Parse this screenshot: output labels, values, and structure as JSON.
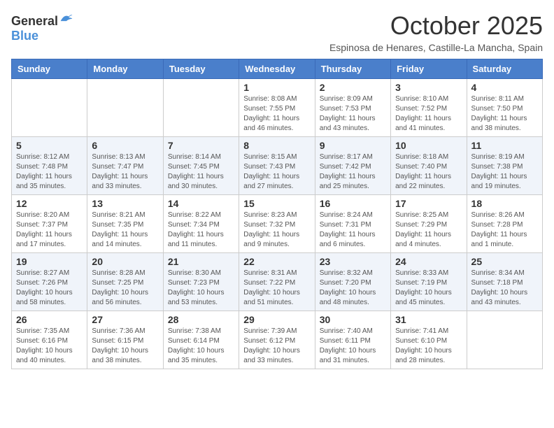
{
  "header": {
    "logo_general": "General",
    "logo_blue": "Blue",
    "month_title": "October 2025",
    "subtitle": "Espinosa de Henares, Castille-La Mancha, Spain"
  },
  "weekdays": [
    "Sunday",
    "Monday",
    "Tuesday",
    "Wednesday",
    "Thursday",
    "Friday",
    "Saturday"
  ],
  "weeks": [
    [
      {
        "day": "",
        "info": ""
      },
      {
        "day": "",
        "info": ""
      },
      {
        "day": "",
        "info": ""
      },
      {
        "day": "1",
        "info": "Sunrise: 8:08 AM\nSunset: 7:55 PM\nDaylight: 11 hours and 46 minutes."
      },
      {
        "day": "2",
        "info": "Sunrise: 8:09 AM\nSunset: 7:53 PM\nDaylight: 11 hours and 43 minutes."
      },
      {
        "day": "3",
        "info": "Sunrise: 8:10 AM\nSunset: 7:52 PM\nDaylight: 11 hours and 41 minutes."
      },
      {
        "day": "4",
        "info": "Sunrise: 8:11 AM\nSunset: 7:50 PM\nDaylight: 11 hours and 38 minutes."
      }
    ],
    [
      {
        "day": "5",
        "info": "Sunrise: 8:12 AM\nSunset: 7:48 PM\nDaylight: 11 hours and 35 minutes."
      },
      {
        "day": "6",
        "info": "Sunrise: 8:13 AM\nSunset: 7:47 PM\nDaylight: 11 hours and 33 minutes."
      },
      {
        "day": "7",
        "info": "Sunrise: 8:14 AM\nSunset: 7:45 PM\nDaylight: 11 hours and 30 minutes."
      },
      {
        "day": "8",
        "info": "Sunrise: 8:15 AM\nSunset: 7:43 PM\nDaylight: 11 hours and 27 minutes."
      },
      {
        "day": "9",
        "info": "Sunrise: 8:17 AM\nSunset: 7:42 PM\nDaylight: 11 hours and 25 minutes."
      },
      {
        "day": "10",
        "info": "Sunrise: 8:18 AM\nSunset: 7:40 PM\nDaylight: 11 hours and 22 minutes."
      },
      {
        "day": "11",
        "info": "Sunrise: 8:19 AM\nSunset: 7:38 PM\nDaylight: 11 hours and 19 minutes."
      }
    ],
    [
      {
        "day": "12",
        "info": "Sunrise: 8:20 AM\nSunset: 7:37 PM\nDaylight: 11 hours and 17 minutes."
      },
      {
        "day": "13",
        "info": "Sunrise: 8:21 AM\nSunset: 7:35 PM\nDaylight: 11 hours and 14 minutes."
      },
      {
        "day": "14",
        "info": "Sunrise: 8:22 AM\nSunset: 7:34 PM\nDaylight: 11 hours and 11 minutes."
      },
      {
        "day": "15",
        "info": "Sunrise: 8:23 AM\nSunset: 7:32 PM\nDaylight: 11 hours and 9 minutes."
      },
      {
        "day": "16",
        "info": "Sunrise: 8:24 AM\nSunset: 7:31 PM\nDaylight: 11 hours and 6 minutes."
      },
      {
        "day": "17",
        "info": "Sunrise: 8:25 AM\nSunset: 7:29 PM\nDaylight: 11 hours and 4 minutes."
      },
      {
        "day": "18",
        "info": "Sunrise: 8:26 AM\nSunset: 7:28 PM\nDaylight: 11 hours and 1 minute."
      }
    ],
    [
      {
        "day": "19",
        "info": "Sunrise: 8:27 AM\nSunset: 7:26 PM\nDaylight: 10 hours and 58 minutes."
      },
      {
        "day": "20",
        "info": "Sunrise: 8:28 AM\nSunset: 7:25 PM\nDaylight: 10 hours and 56 minutes."
      },
      {
        "day": "21",
        "info": "Sunrise: 8:30 AM\nSunset: 7:23 PM\nDaylight: 10 hours and 53 minutes."
      },
      {
        "day": "22",
        "info": "Sunrise: 8:31 AM\nSunset: 7:22 PM\nDaylight: 10 hours and 51 minutes."
      },
      {
        "day": "23",
        "info": "Sunrise: 8:32 AM\nSunset: 7:20 PM\nDaylight: 10 hours and 48 minutes."
      },
      {
        "day": "24",
        "info": "Sunrise: 8:33 AM\nSunset: 7:19 PM\nDaylight: 10 hours and 45 minutes."
      },
      {
        "day": "25",
        "info": "Sunrise: 8:34 AM\nSunset: 7:18 PM\nDaylight: 10 hours and 43 minutes."
      }
    ],
    [
      {
        "day": "26",
        "info": "Sunrise: 7:35 AM\nSunset: 6:16 PM\nDaylight: 10 hours and 40 minutes."
      },
      {
        "day": "27",
        "info": "Sunrise: 7:36 AM\nSunset: 6:15 PM\nDaylight: 10 hours and 38 minutes."
      },
      {
        "day": "28",
        "info": "Sunrise: 7:38 AM\nSunset: 6:14 PM\nDaylight: 10 hours and 35 minutes."
      },
      {
        "day": "29",
        "info": "Sunrise: 7:39 AM\nSunset: 6:12 PM\nDaylight: 10 hours and 33 minutes."
      },
      {
        "day": "30",
        "info": "Sunrise: 7:40 AM\nSunset: 6:11 PM\nDaylight: 10 hours and 31 minutes."
      },
      {
        "day": "31",
        "info": "Sunrise: 7:41 AM\nSunset: 6:10 PM\nDaylight: 10 hours and 28 minutes."
      },
      {
        "day": "",
        "info": ""
      }
    ]
  ]
}
